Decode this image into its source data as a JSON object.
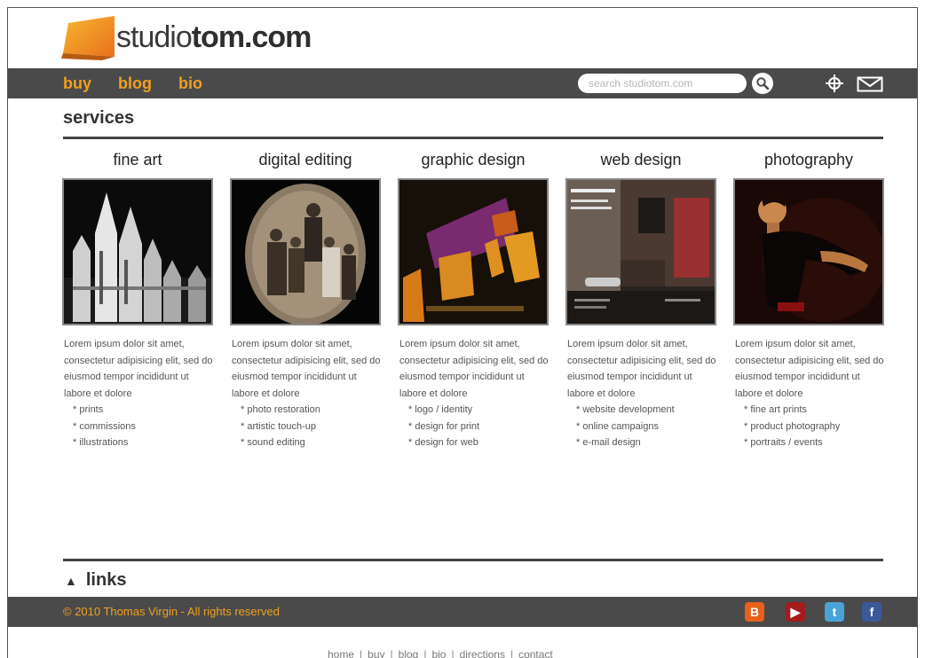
{
  "header": {
    "logo_light": "studio",
    "logo_bold": "tom.com"
  },
  "nav": {
    "links": [
      "buy",
      "blog",
      "bio"
    ],
    "search_placeholder": "search studiotom.com"
  },
  "services": {
    "title": "services",
    "items": [
      {
        "title": "fine art",
        "description": "Lorem ipsum dolor sit amet, consectetur adipisicing elit, sed do eiusmod tempor incididunt ut labore et dolore",
        "bullets": [
          "prints",
          "commissions",
          "illustrations"
        ]
      },
      {
        "title": "digital editing",
        "description": "Lorem ipsum dolor sit amet, consectetur adipisicing elit, sed do eiusmod tempor incididunt ut labore et dolore",
        "bullets": [
          "photo restoration",
          "artistic touch-up",
          "sound editing"
        ]
      },
      {
        "title": "graphic design",
        "description": "Lorem ipsum dolor sit amet, consectetur adipisicing elit, sed do eiusmod tempor incididunt ut labore et dolore",
        "bullets": [
          "logo / identity",
          "design for print",
          "design for web"
        ]
      },
      {
        "title": "web design",
        "description": "Lorem ipsum dolor sit amet, consectetur adipisicing elit, sed do eiusmod tempor incididunt ut labore et dolore",
        "bullets": [
          "website development",
          "online campaigns",
          "e-mail design"
        ]
      },
      {
        "title": "photography",
        "description": "Lorem ipsum dolor sit amet, consectetur adipisicing elit, sed do eiusmod tempor incididunt ut labore et dolore",
        "bullets": [
          "fine art prints",
          "product photography",
          "portraits / events"
        ]
      }
    ]
  },
  "links_section": {
    "label": "links"
  },
  "footer": {
    "copyright": "© 2010 Thomas Virgin - All rights reserved",
    "social_icons": [
      "blogger-icon",
      "youtube-icon",
      "twitter-icon",
      "facebook-icon"
    ],
    "social_colors": [
      "#e8601c",
      "#a41c1c",
      "#4aa3d8",
      "#3b5998"
    ],
    "bottom_links": [
      "home",
      "buy",
      "blog",
      "bio",
      "directions",
      "contact"
    ]
  },
  "colors": {
    "accent": "#f0a020",
    "bar": "#4a4a4a"
  }
}
